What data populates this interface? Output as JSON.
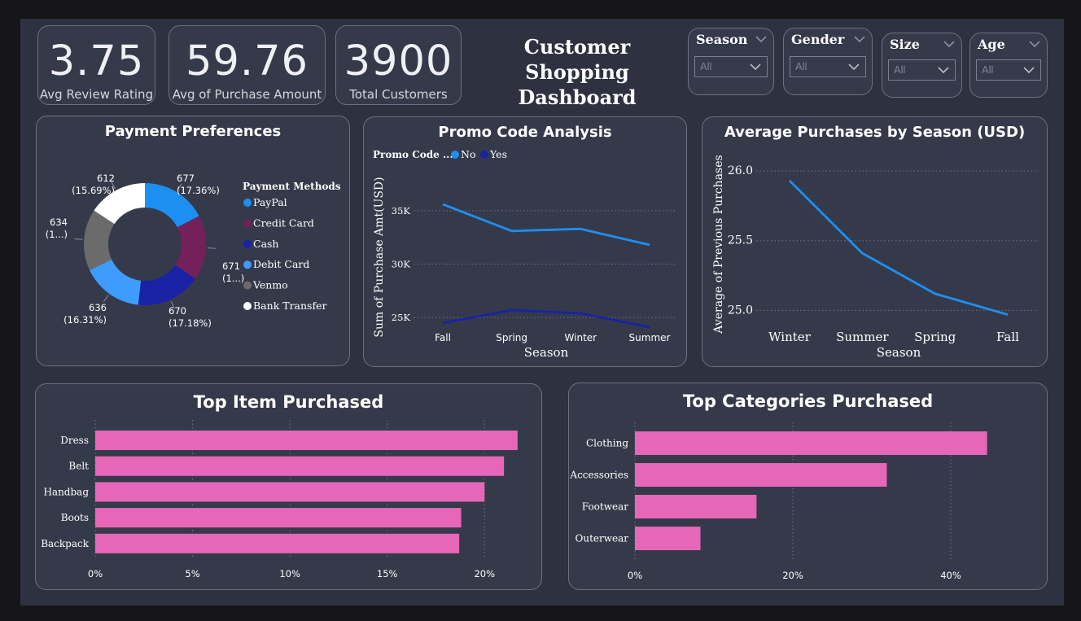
{
  "kpis": [
    {
      "value": "3.75",
      "label": "Avg Review Rating"
    },
    {
      "value": "59.76",
      "label": "Avg of Purchase Amount"
    },
    {
      "value": "3900",
      "label": "Total Customers"
    }
  ],
  "title": {
    "line1": "Customer Shopping",
    "line2": "Dashboard"
  },
  "slicers": [
    {
      "label": "Season",
      "value": "All"
    },
    {
      "label": "Gender",
      "value": "All"
    },
    {
      "label": "Size",
      "value": "All"
    },
    {
      "label": "Age",
      "value": "All"
    }
  ],
  "payment": {
    "title": "Payment Preferences",
    "legend_title": "Payment Methods",
    "chart_data": {
      "type": "pie",
      "variant": "donut",
      "slices": [
        {
          "name": "PayPal",
          "value": 677,
          "pct": "(17.36%)",
          "color": "#1e8ff2"
        },
        {
          "name": "Credit Card",
          "value": 671,
          "pct": "(1...)",
          "color": "#74205a"
        },
        {
          "name": "Cash",
          "value": 670,
          "pct": "(17.18%)",
          "color": "#1a22a6"
        },
        {
          "name": "Debit Card",
          "value": 636,
          "pct": "(16.31%)",
          "color": "#3e9cff"
        },
        {
          "name": "Venmo",
          "value": 634,
          "pct": "(1...)",
          "color": "#6b6b6b"
        },
        {
          "name": "Bank Transfer",
          "value": 612,
          "pct": "(15.69%)",
          "color": "#ffffff"
        }
      ]
    }
  },
  "promo": {
    "title": "Promo Code Analysis",
    "legend_title": "Promo Code ...",
    "chart_data": {
      "type": "line",
      "categories": [
        "Fall",
        "Spring",
        "Winter",
        "Summer"
      ],
      "series": [
        {
          "name": "No",
          "values": [
            35600,
            33100,
            33300,
            31800
          ],
          "color": "#1e8ff2"
        },
        {
          "name": "Yes",
          "values": [
            24500,
            25700,
            25400,
            24100
          ],
          "color": "#1a22a6"
        }
      ],
      "ticks": [
        25000,
        30000,
        35000
      ],
      "tick_labels": [
        "25K",
        "30K",
        "35K"
      ],
      "ylim": [
        24100,
        37200
      ],
      "xlabel": "Season",
      "ylabel": "Sum of Purchase Amt(USD)"
    }
  },
  "season": {
    "title": "Average Purchases by Season (USD)",
    "chart_data": {
      "type": "line",
      "categories": [
        "Winter",
        "Summer",
        "Spring",
        "Fall"
      ],
      "series": [
        {
          "values": [
            25.93,
            25.41,
            25.12,
            24.97
          ],
          "color": "#1e8ff2"
        }
      ],
      "ticks": [
        25.0,
        25.5,
        26.0
      ],
      "tick_labels": [
        "25.0",
        "25.5",
        "26.0"
      ],
      "ylim": [
        24.95,
        26.0
      ],
      "xlabel": "Season",
      "ylabel": "Average of Previous Purchases"
    }
  },
  "items": {
    "title": "Top Item Purchased",
    "chart_data": {
      "type": "bar",
      "orientation": "horizontal",
      "categories": [
        "Dress",
        "Belt",
        "Handbag",
        "Boots",
        "Backpack"
      ],
      "values": [
        21.7,
        21.0,
        20.0,
        18.8,
        18.7
      ],
      "ticks": [
        0,
        5,
        10,
        15,
        20
      ],
      "tick_labels": [
        "0%",
        "5%",
        "10%",
        "15%",
        "20%"
      ],
      "xlim": [
        0,
        22.5
      ],
      "color": "#e667b8"
    }
  },
  "categories": {
    "title": "Top Categories Purchased",
    "chart_data": {
      "type": "bar",
      "orientation": "horizontal",
      "categories": [
        "Clothing",
        "Accessories",
        "Footwear",
        "Outerwear"
      ],
      "values": [
        44.6,
        31.9,
        15.4,
        8.3
      ],
      "ticks": [
        0,
        20,
        40
      ],
      "tick_labels": [
        "0%",
        "20%",
        "40%"
      ],
      "xlim": [
        0,
        50
      ],
      "color": "#e667b8"
    }
  }
}
